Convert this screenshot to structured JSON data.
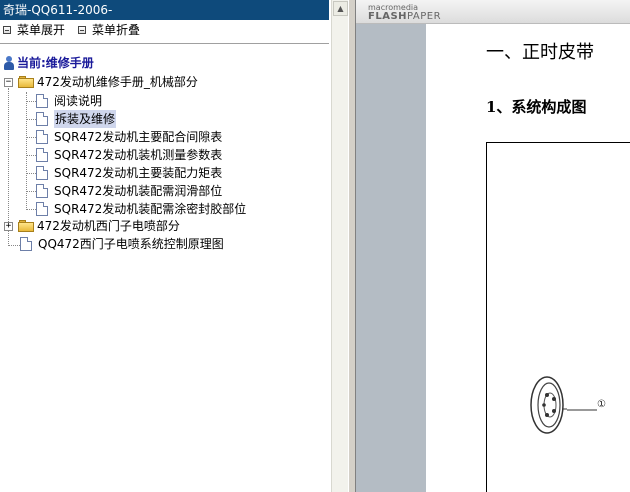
{
  "window": {
    "title": "奇瑞-QQ611-2006-"
  },
  "toolbar": {
    "expand_label": "菜单展开",
    "collapse_label": "菜单折叠"
  },
  "tree": {
    "current": "当前:维修手册",
    "folder1": {
      "label": "472发动机维修手册_机械部分",
      "expander": "−",
      "items": [
        "阅读说明",
        "拆装及维修",
        "SQR472发动机主要配合间隙表",
        "SQR472发动机装机测量参数表",
        "SQR472发动机主要装配力矩表",
        "SQR472发动机装配需润滑部位",
        "SQR472发动机装配需涂密封胶部位"
      ],
      "selected_index": 1
    },
    "folder2": {
      "label": "472发动机西门子电喷部分",
      "expander": "+"
    },
    "doc_item": {
      "label": "QQ472西门子电喷系统控制原理图"
    }
  },
  "viewer": {
    "logo_line1": "macromedia",
    "logo_line2_bold": "FLASH",
    "logo_line2_light": "PAPER",
    "heading1": "一、正时皮带",
    "heading2": "1、系统构成图",
    "callout": "①"
  },
  "colors": {
    "titlebar": "#0e4a7b",
    "selected": "#cfd6ec",
    "viewer_grey": "#b4bcc4"
  }
}
